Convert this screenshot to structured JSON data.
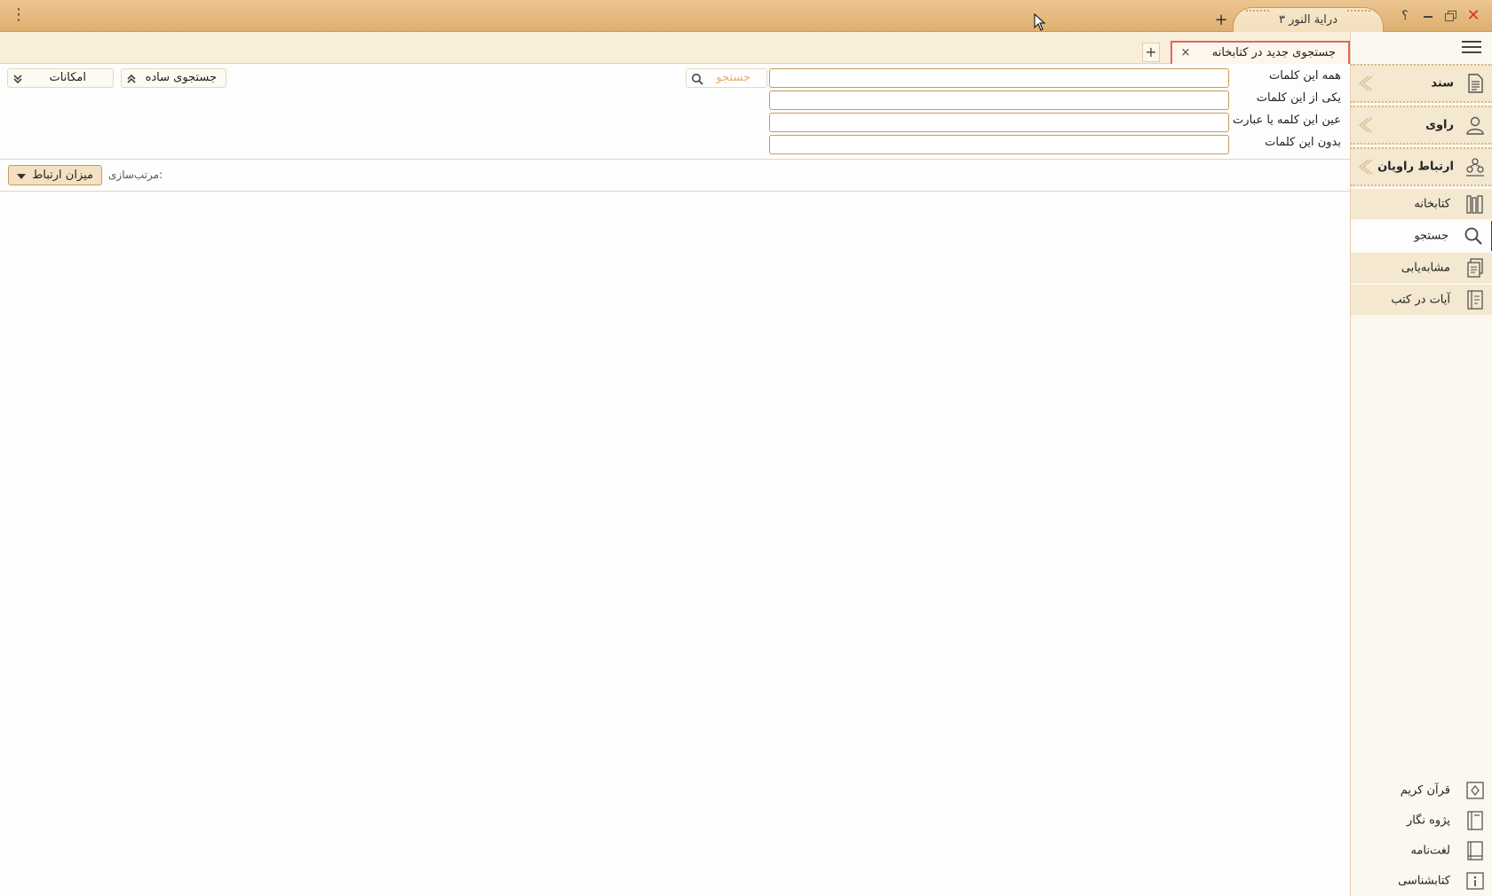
{
  "app": {
    "tab_title": "درایة النور ۳",
    "help_label": "؟"
  },
  "doc_tabs": [
    {
      "label": "جستجوی جدید در کتابخانه",
      "active": true
    }
  ],
  "search_form": {
    "rows": [
      {
        "label": "همه این کلمات",
        "value": ""
      },
      {
        "label": "یکی از این کلمات",
        "value": ""
      },
      {
        "label": "عین این کلمه یا عبارت",
        "value": ""
      },
      {
        "label": "بدون این کلمات",
        "value": ""
      }
    ],
    "search_button": "جستجو",
    "simple_search_button": "جستجوی ساده",
    "options_button": "امکانات"
  },
  "sort": {
    "label": "مرتب‌سازی:",
    "selected": "میزان ارتباط"
  },
  "sidebar": {
    "items": [
      {
        "label": "سند",
        "icon": "document-icon",
        "style": "fancy"
      },
      {
        "label": "راوی",
        "icon": "person-icon",
        "style": "fancy"
      },
      {
        "label": "ارتباط راویان",
        "icon": "people-network-icon",
        "style": "fancy"
      },
      {
        "label": "کتابخانه",
        "icon": "library-books-icon",
        "style": "plain"
      },
      {
        "label": "جستجو",
        "icon": "search-icon",
        "style": "active"
      },
      {
        "label": "مشابه‌یابی",
        "icon": "similar-documents-icon",
        "style": "plain"
      },
      {
        "label": "آیات در کتب",
        "icon": "verses-book-icon",
        "style": "plain"
      }
    ],
    "bottom_items": [
      {
        "label": "قرآن کریم",
        "icon": "quran-icon"
      },
      {
        "label": "پژوه نگار",
        "icon": "notebook-icon"
      },
      {
        "label": "لغت‌نامه",
        "icon": "dictionary-icon"
      },
      {
        "label": "کتابشناسی",
        "icon": "info-book-icon"
      }
    ]
  },
  "colors": {
    "titlebar": "#e4bb80",
    "accent_border": "#c89b5a",
    "sidebar_bg": "#f4e8d0",
    "active_tab_border": "#e06666",
    "close": "#d9342b"
  }
}
